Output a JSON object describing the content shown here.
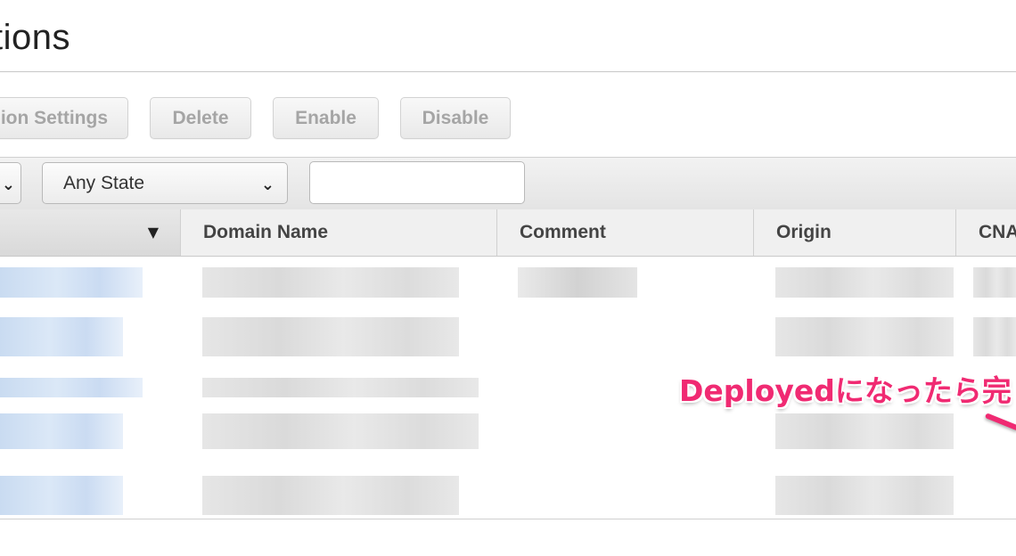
{
  "page": {
    "title": "tions"
  },
  "toolbar": {
    "settings_label": "ion Settings",
    "delete_label": "Delete",
    "enable_label": "Enable",
    "disable_label": "Disable"
  },
  "filters": {
    "state_value": "Any State",
    "search_value": ""
  },
  "table": {
    "columns": [
      "",
      "Domain Name",
      "Comment",
      "Origin",
      "CNA"
    ]
  },
  "annotation": {
    "text": "Deployedになったら完",
    "color": "#f02a72"
  }
}
